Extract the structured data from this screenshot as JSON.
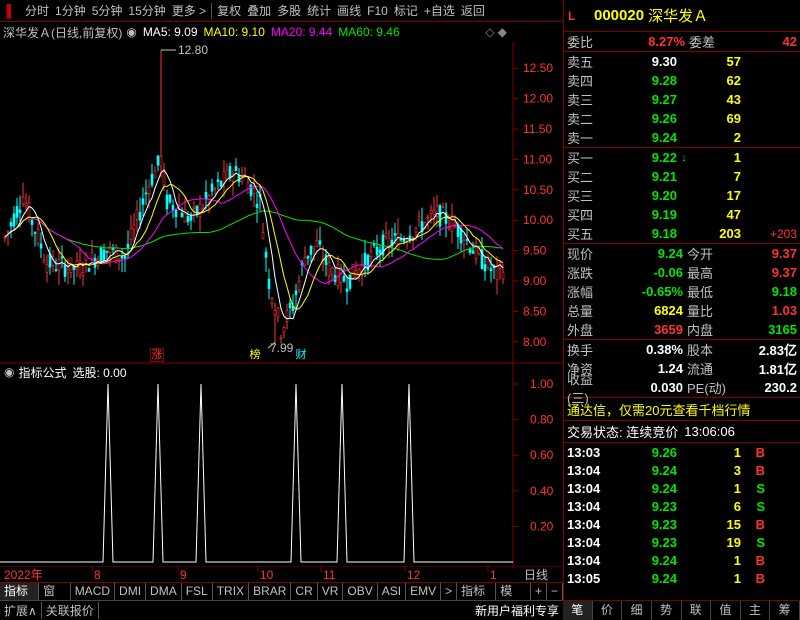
{
  "toolbar": {
    "items": [
      "分时",
      "1分钟",
      "5分钟",
      "15分钟",
      "更多 >",
      "复权",
      "叠加",
      "多股",
      "统计",
      "画线",
      "F10",
      "标记",
      "+自选",
      "返回"
    ]
  },
  "chart_header": {
    "stock": "深华发Ａ(日线,前复权)",
    "ma5": "MA5: 9.09",
    "ma10": "MA10: 9.10",
    "ma20": "MA20: 9.44",
    "ma60": "MA60: 9.46"
  },
  "main_chart": {
    "y_ticks": [
      "12.50",
      "12.00",
      "11.50",
      "11.00",
      "10.50",
      "10.00",
      "9.50",
      "9.00",
      "8.50",
      "8.00"
    ],
    "high_marker": "12.80",
    "low_marker": "7.99",
    "flags": [
      "涨",
      "榜",
      "财"
    ]
  },
  "indicator": {
    "title": "指标公式",
    "value_label": "选股: 0.00",
    "y_ticks": [
      "1.00",
      "0.80",
      "0.60",
      "0.40",
      "0.20"
    ]
  },
  "x_axis": {
    "labels": [
      "2022年",
      "8",
      "9",
      "10",
      "11",
      "12",
      "1"
    ],
    "period": "日线"
  },
  "tabs": [
    "指标A",
    "窗口",
    "MACD",
    "DMI",
    "DMA",
    "FSL",
    "TRIX",
    "BRAR",
    "CR",
    "VR",
    "OBV",
    "ASI",
    "EMV",
    ">",
    "指标B",
    "模 板",
    "+",
    "−"
  ],
  "status_bar": {
    "left": [
      "扩展∧",
      "关联报价"
    ],
    "right": "新用户福利专享"
  },
  "quote": {
    "code": "000020",
    "name": "深华发Ａ",
    "weibi_label": "委比",
    "weibi": "8.27%",
    "weicha_label": "委差",
    "weicha": "42",
    "asks": [
      {
        "label": "卖五",
        "price": "9.30",
        "vol": "57"
      },
      {
        "label": "卖四",
        "price": "9.28",
        "vol": "62"
      },
      {
        "label": "卖三",
        "price": "9.27",
        "vol": "43"
      },
      {
        "label": "卖二",
        "price": "9.26",
        "vol": "69"
      },
      {
        "label": "卖一",
        "price": "9.24",
        "vol": "2"
      }
    ],
    "bids": [
      {
        "label": "买一",
        "price": "9.22",
        "vol": "1",
        "extra": "↓"
      },
      {
        "label": "买二",
        "price": "9.21",
        "vol": "7",
        "extra": ""
      },
      {
        "label": "买三",
        "price": "9.20",
        "vol": "17",
        "extra": ""
      },
      {
        "label": "买四",
        "price": "9.19",
        "vol": "47",
        "extra": ""
      },
      {
        "label": "买五",
        "price": "9.18",
        "vol": "203",
        "extra": "+203"
      }
    ],
    "stats": [
      {
        "l1": "现价",
        "v1": "9.24",
        "l2": "今开",
        "v2": "9.37"
      },
      {
        "l1": "涨跌",
        "v1": "-0.06",
        "l2": "最高",
        "v2": "9.37"
      },
      {
        "l1": "涨幅",
        "v1": "-0.65%",
        "l2": "最低",
        "v2": "9.18"
      },
      {
        "l1": "总量",
        "v1": "6824",
        "l2": "量比",
        "v2": "1.03"
      },
      {
        "l1": "外盘",
        "v1": "3659",
        "l2": "内盘",
        "v2": "3165"
      }
    ],
    "stats2": [
      {
        "l1": "换手",
        "v1": "0.38%",
        "l2": "股本",
        "v2": "2.83亿"
      },
      {
        "l1": "净资",
        "v1": "1.24",
        "l2": "流通",
        "v2": "1.81亿"
      },
      {
        "l1": "收益(三)",
        "v1": "0.030",
        "l2": "PE(动)",
        "v2": "230.2"
      }
    ],
    "promo": "通达信，仅需20元查看千档行情",
    "trade_status_label": "交易状态: 连续竞价",
    "trade_time": "13:06:06",
    "ticks": [
      {
        "time": "13:03",
        "price": "9.26",
        "vol": "1",
        "side": "B"
      },
      {
        "time": "13:04",
        "price": "9.24",
        "vol": "3",
        "side": "B"
      },
      {
        "time": "13:04",
        "price": "9.24",
        "vol": "1",
        "side": "S"
      },
      {
        "time": "13:04",
        "price": "9.23",
        "vol": "6",
        "side": "S"
      },
      {
        "time": "13:04",
        "price": "9.23",
        "vol": "15",
        "side": "B"
      },
      {
        "time": "13:04",
        "price": "9.23",
        "vol": "19",
        "side": "S"
      },
      {
        "time": "13:04",
        "price": "9.24",
        "vol": "1",
        "side": "B"
      },
      {
        "time": "13:05",
        "price": "9.24",
        "vol": "1",
        "side": "B"
      }
    ],
    "tabs": [
      "笔",
      "价",
      "细",
      "势",
      "联",
      "值",
      "主",
      "筹"
    ]
  },
  "colors": {
    "up": "#ff3232",
    "down": "#00ffff",
    "ma5": "#ffffff",
    "ma10": "#ffff00",
    "ma20": "#ff00ff",
    "ma60": "#00e600",
    "grid": "#800000"
  }
}
